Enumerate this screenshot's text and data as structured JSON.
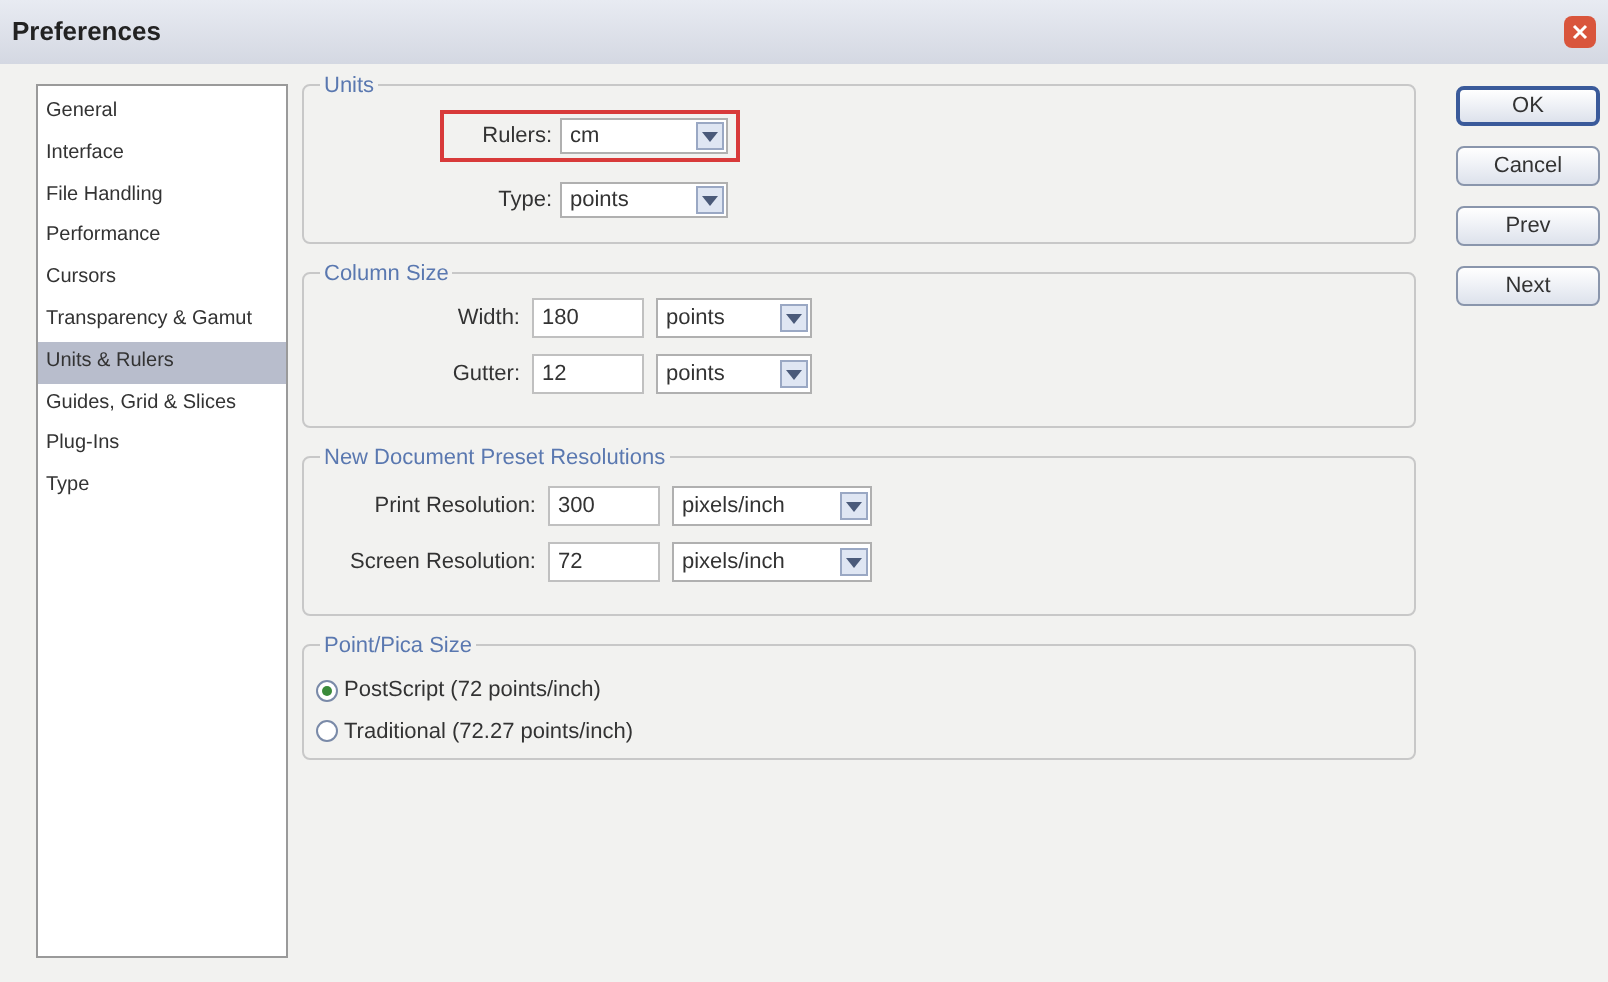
{
  "window": {
    "title": "Preferences"
  },
  "sidebar": {
    "items": [
      {
        "label": "General",
        "selected": false
      },
      {
        "label": "Interface",
        "selected": false
      },
      {
        "label": "File Handling",
        "selected": false
      },
      {
        "label": "Performance",
        "selected": false
      },
      {
        "label": "Cursors",
        "selected": false
      },
      {
        "label": "Transparency & Gamut",
        "selected": false
      },
      {
        "label": "Units & Rulers",
        "selected": true
      },
      {
        "label": "Guides, Grid & Slices",
        "selected": false
      },
      {
        "label": "Plug-Ins",
        "selected": false
      },
      {
        "label": "Type",
        "selected": false
      }
    ]
  },
  "units": {
    "title": "Units",
    "rows": [
      {
        "label": "Rulers:",
        "value": "cm",
        "highlighted": true
      },
      {
        "label": "Type:",
        "value": "points",
        "highlighted": false
      }
    ]
  },
  "column_size": {
    "title": "Column Size",
    "rows": [
      {
        "label": "Width:",
        "value": "180",
        "unit": "points"
      },
      {
        "label": "Gutter:",
        "value": "12",
        "unit": "points"
      }
    ]
  },
  "resolution": {
    "title": "New Document Preset Resolutions",
    "rows": [
      {
        "label": "Print Resolution:",
        "value": "300",
        "unit": "pixels/inch"
      },
      {
        "label": "Screen Resolution:",
        "value": "72",
        "unit": "pixels/inch"
      }
    ]
  },
  "point_size": {
    "title": "Point/Pica Size",
    "options": [
      {
        "label": "PostScript (72 points/inch)",
        "selected": true
      },
      {
        "label": "Traditional (72.27 points/inch)",
        "selected": false
      }
    ]
  },
  "buttons": [
    "OK",
    "Cancel",
    "Prev",
    "Next"
  ]
}
